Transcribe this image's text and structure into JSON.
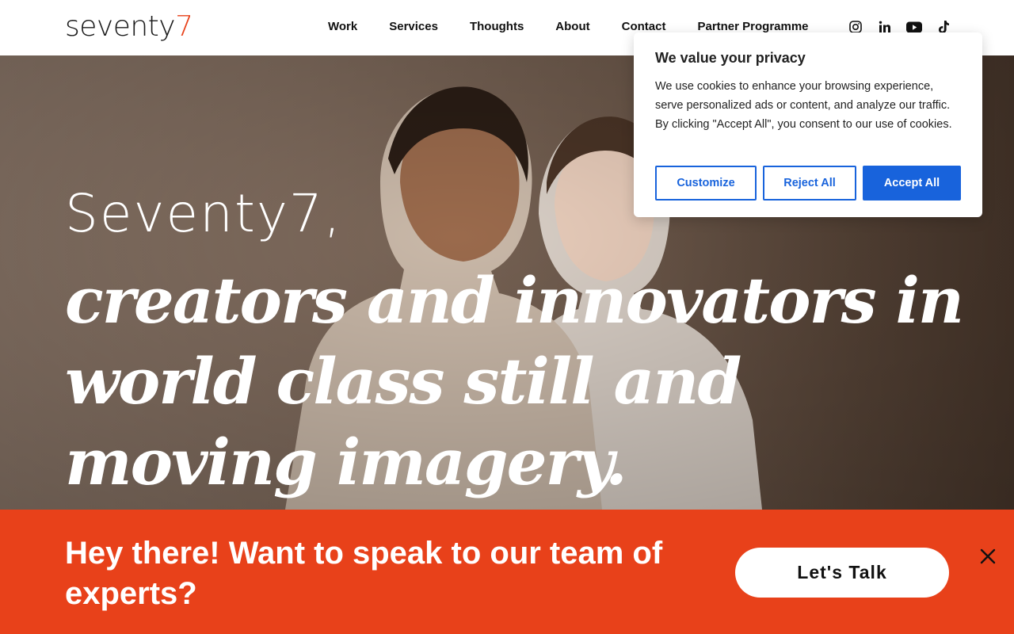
{
  "header": {
    "logo_text": "seventy",
    "logo_digit": "7",
    "nav": [
      "Work",
      "Services",
      "Thoughts",
      "About",
      "Contact",
      "Partner Programme"
    ],
    "social_icons": [
      "instagram-icon",
      "linkedin-icon",
      "youtube-icon",
      "tiktok-icon"
    ]
  },
  "hero": {
    "intro": "Seventy7,",
    "headline": "creators and innovators in world class still and moving imagery."
  },
  "cookie": {
    "title": "We value your privacy",
    "text": "We use cookies to enhance your browsing experience, serve personalized ads or content, and analyze our traffic. By clicking \"Accept All\", you consent to our use of cookies.",
    "customize": "Customize",
    "reject": "Reject All",
    "accept": "Accept All",
    "accent_color": "#1863dc"
  },
  "cta_bar": {
    "text": "Hey there! Want to speak to our team of experts?",
    "button": "Let's Talk",
    "color": "#e8411a"
  }
}
